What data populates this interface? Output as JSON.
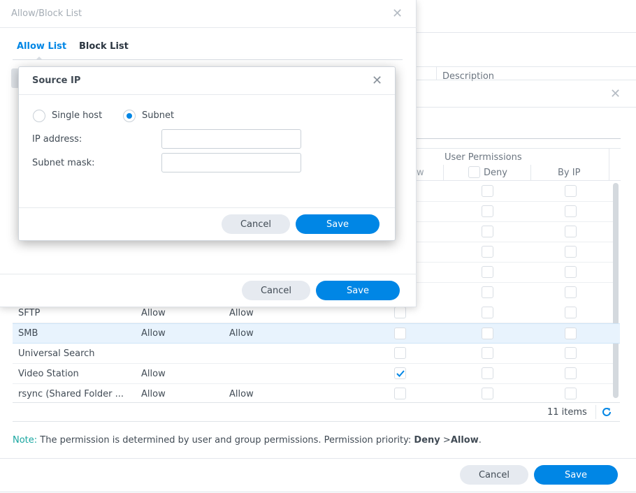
{
  "back_window": {
    "column_description": "Description",
    "user_permissions_header": "User Permissions",
    "col_deny": "Deny",
    "col_by_ip": "By IP",
    "col_allow_partial": "w",
    "rows": [
      {
        "name": "SFTP",
        "c1": "Allow",
        "c2": "Allow",
        "allow_checked": false
      },
      {
        "name": "SMB",
        "c1": "Allow",
        "c2": "Allow",
        "allow_checked": false,
        "selected": true
      },
      {
        "name": "Universal Search",
        "c1": "",
        "c2": "",
        "allow_checked": false
      },
      {
        "name": "Video Station",
        "c1": "Allow",
        "c2": "",
        "allow_checked": true
      },
      {
        "name": "rsync (Shared Folder ...",
        "c1": "Allow",
        "c2": "Allow",
        "allow_checked": false
      }
    ],
    "items_count": "11 items",
    "note_label": "Note:",
    "note_text": "The permission is determined by user and group permissions. Permission priority:",
    "note_deny": "Deny",
    "note_gt": ">",
    "note_allow": "Allow",
    "note_end": ".",
    "cancel_label": "Cancel",
    "save_label": "Save",
    "accent": "#0086e5"
  },
  "allow_block_dialog": {
    "title": "Allow/Block List",
    "tabs": [
      {
        "label": "Allow List",
        "active": true
      },
      {
        "label": "Block List",
        "active": false
      }
    ],
    "cancel_label": "Cancel",
    "save_label": "Save"
  },
  "source_ip_dialog": {
    "title": "Source IP",
    "radio_single_host": "Single host",
    "radio_subnet": "Subnet",
    "selected_option": "Subnet",
    "ip_label": "IP address:",
    "ip_value": "",
    "mask_label": "Subnet mask:",
    "mask_value": "",
    "cancel_label": "Cancel",
    "save_label": "Save"
  }
}
